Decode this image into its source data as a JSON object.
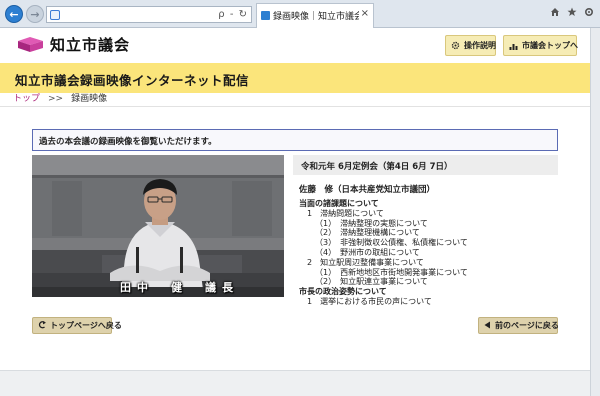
{
  "browser": {
    "tab_title": "録画映像｜知立市議会イン...",
    "tab_close": "×",
    "addr_tools": "ρ - ↻"
  },
  "site": {
    "name": "知立市議会",
    "buttons": {
      "ops_guide": "操作説明",
      "council_top": "市議会トップへ"
    },
    "page_title": "知立市議会録画映像インターネット配信"
  },
  "breadcrumb": {
    "home": "トップ",
    "separator": ">>",
    "current": "録画映像"
  },
  "notice": "過去の本会議の録画映像を御覧いただけます。",
  "video": {
    "caption": "田中　健　議長"
  },
  "meeting": {
    "title": "令和元年 6月定例会（第4日 6月 7日）",
    "speaker": "佐藤　修（日本共産党知立市議団）",
    "agenda": [
      {
        "level": "h",
        "text": "当面の諸課題について"
      },
      {
        "level": "l1",
        "text": "1　滞納問題について"
      },
      {
        "level": "l2",
        "text": "（1）　滞納整理の実態について"
      },
      {
        "level": "l2",
        "text": "（2）　滞納整理機構について"
      },
      {
        "level": "l2",
        "text": "（3）　非強制徴収公債権、私債権について"
      },
      {
        "level": "l2",
        "text": "（4）　野洲市の取組について"
      },
      {
        "level": "l1",
        "text": "2　知立駅周辺整備事業について"
      },
      {
        "level": "l2",
        "text": "（1）　西新地地区市街地開発事業について"
      },
      {
        "level": "l2",
        "text": "（2）　知立駅連立事業について"
      },
      {
        "level": "h",
        "text": "市長の政治姿勢について"
      },
      {
        "level": "l1",
        "text": "1　選挙における市民の声について"
      }
    ]
  },
  "footer": {
    "back_top": "トップページへ戻る",
    "back_prev": "前のページに戻る"
  },
  "colors": {
    "accent_purple": "#b0307f",
    "title_band": "#fbe57b",
    "header_button": "#f6ecb5",
    "footer_button": "#ded2ac",
    "notice_border": "#5b6bb4"
  },
  "icons": [
    "back-arrow-icon",
    "forward-arrow-icon",
    "home-icon",
    "star-icon",
    "settings-icon",
    "gear-icon",
    "people-icon",
    "return-arrow-icon",
    "left-triangle-icon"
  ]
}
